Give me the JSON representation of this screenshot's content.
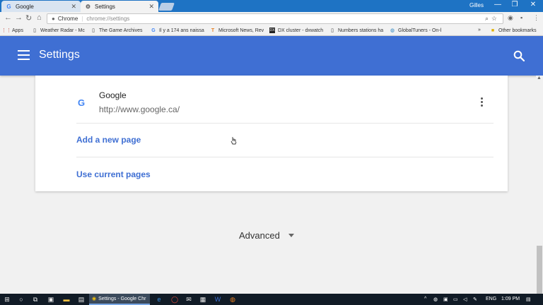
{
  "browser": {
    "tabs": [
      {
        "title": "Google",
        "favicon": "G",
        "active": false
      },
      {
        "title": "Settings",
        "favicon": "⚙",
        "active": true
      }
    ],
    "profile_name": "Gilles",
    "window_controls": {
      "minimize": "—",
      "maximize": "❐",
      "close": "✕"
    },
    "omnibox": {
      "site_label": "Chrome",
      "url": "chrome://settings"
    },
    "bookmarks": [
      {
        "label": "Apps",
        "icon": "apps-grid-icon"
      },
      {
        "label": "Weather Radar - Mc",
        "icon": "page-icon"
      },
      {
        "label": "The Game Archives",
        "icon": "page-icon"
      },
      {
        "label": "Il y a 174 ans naissa",
        "icon": "G"
      },
      {
        "label": "Microsoft News, Rev",
        "icon": "T"
      },
      {
        "label": "DX cluster - dxwatch",
        "icon": "DX"
      },
      {
        "label": "Numbers stations ha",
        "icon": "page-icon"
      },
      {
        "label": "GlobalTuners - On-l",
        "icon": "globe-icon"
      }
    ],
    "bookmarks_overflow": "»",
    "other_bookmarks": "Other bookmarks"
  },
  "settings": {
    "title": "Settings",
    "startup_page": {
      "name": "Google",
      "url": "http://www.google.ca/"
    },
    "add_page_label": "Add a new page",
    "use_current_label": "Use current pages",
    "advanced_label": "Advanced"
  },
  "taskbar": {
    "active_app": "Settings - Google Chr",
    "language": "ENG",
    "time": "1:09 PM"
  },
  "colors": {
    "header": "#3f6fd3",
    "link": "#3f6fd3",
    "tabstrip": "#1e73c4",
    "taskbar": "#111b26"
  }
}
